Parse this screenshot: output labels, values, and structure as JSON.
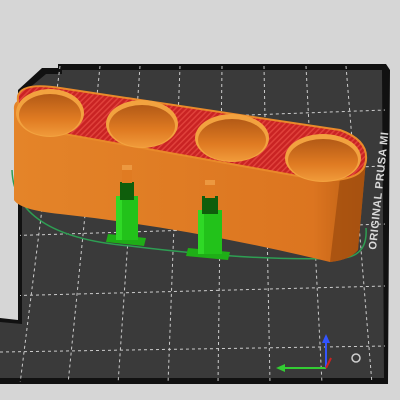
{
  "viewport": {
    "background_color": "#d6d6d6",
    "bed": {
      "label": "ORIGINAL PRUSA MI",
      "surface_color": "#3a3a3a",
      "frame_color": "#111111",
      "grid_color": "#e6e6e6",
      "grid": "dashed"
    },
    "model": {
      "name": "4-cup holder",
      "holes": 4,
      "perimeter_color": "#e07a1f",
      "infill_color": "#d42a2a",
      "support_color": "#22c21a",
      "skirt_color": "#2e9e53"
    },
    "axes": {
      "x_color": "#33cc33",
      "z_color": "#3355ff"
    }
  }
}
